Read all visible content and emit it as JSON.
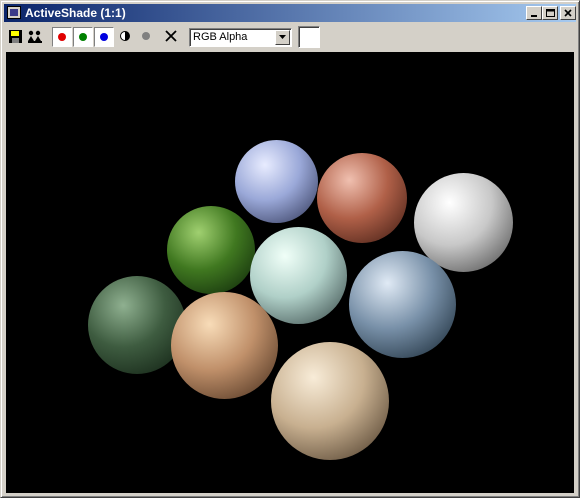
{
  "window": {
    "title": "ActiveShade (1:1)",
    "title_bar_gradient": [
      "#0a246a",
      "#a6caf0"
    ]
  },
  "window_controls": {
    "minimize_icon": "minimize-icon",
    "maximize_icon": "maximize-icon",
    "close_icon": "close-icon"
  },
  "toolbar": {
    "buttons": [
      {
        "name": "save-image-button",
        "icon": "floppy-disk-icon"
      },
      {
        "name": "clone-window-button",
        "icon": "clone-icon"
      },
      {
        "name": "red-channel-button",
        "icon": "red-dot-icon",
        "color": "#e00000"
      },
      {
        "name": "green-channel-button",
        "icon": "green-dot-icon",
        "color": "#008000"
      },
      {
        "name": "blue-channel-button",
        "icon": "blue-dot-icon",
        "color": "#0000e0"
      },
      {
        "name": "display-alpha-button",
        "icon": "half-circle-icon"
      },
      {
        "name": "monochrome-button",
        "icon": "gray-dot-icon",
        "color": "#808080"
      },
      {
        "name": "clear-button",
        "icon": "x-icon"
      }
    ],
    "channel_select": {
      "selected": "RGB Alpha"
    },
    "color_swatch": {
      "color": "#ffffff"
    }
  },
  "viewport": {
    "background": "#000000",
    "spheres": [
      {
        "material": "pale-blue",
        "colors": [
          "#e8ecff",
          "#9aa8d8",
          "#2a3050"
        ]
      },
      {
        "material": "brick",
        "colors": [
          "#f0c0b0",
          "#b06048",
          "#3a1810"
        ]
      },
      {
        "material": "chrome",
        "colors": [
          "#ffffff",
          "#c8c8c8",
          "#404040"
        ]
      },
      {
        "material": "grass",
        "colors": [
          "#a0d070",
          "#407820",
          "#0a2008"
        ]
      },
      {
        "material": "pale-green",
        "colors": [
          "#f0fff8",
          "#b0d0c8",
          "#304040"
        ]
      },
      {
        "material": "sky-reflection",
        "colors": [
          "#e0eaf5",
          "#7890a8",
          "#10202c"
        ]
      },
      {
        "material": "dark-green",
        "colors": [
          "#8fb090",
          "#3e5c40",
          "#0c1a0e"
        ]
      },
      {
        "material": "wood",
        "colors": [
          "#f8dcb8",
          "#c0906a",
          "#402818"
        ]
      },
      {
        "material": "stone",
        "colors": [
          "#f8ecd8",
          "#c8b090",
          "#403020"
        ]
      }
    ]
  }
}
